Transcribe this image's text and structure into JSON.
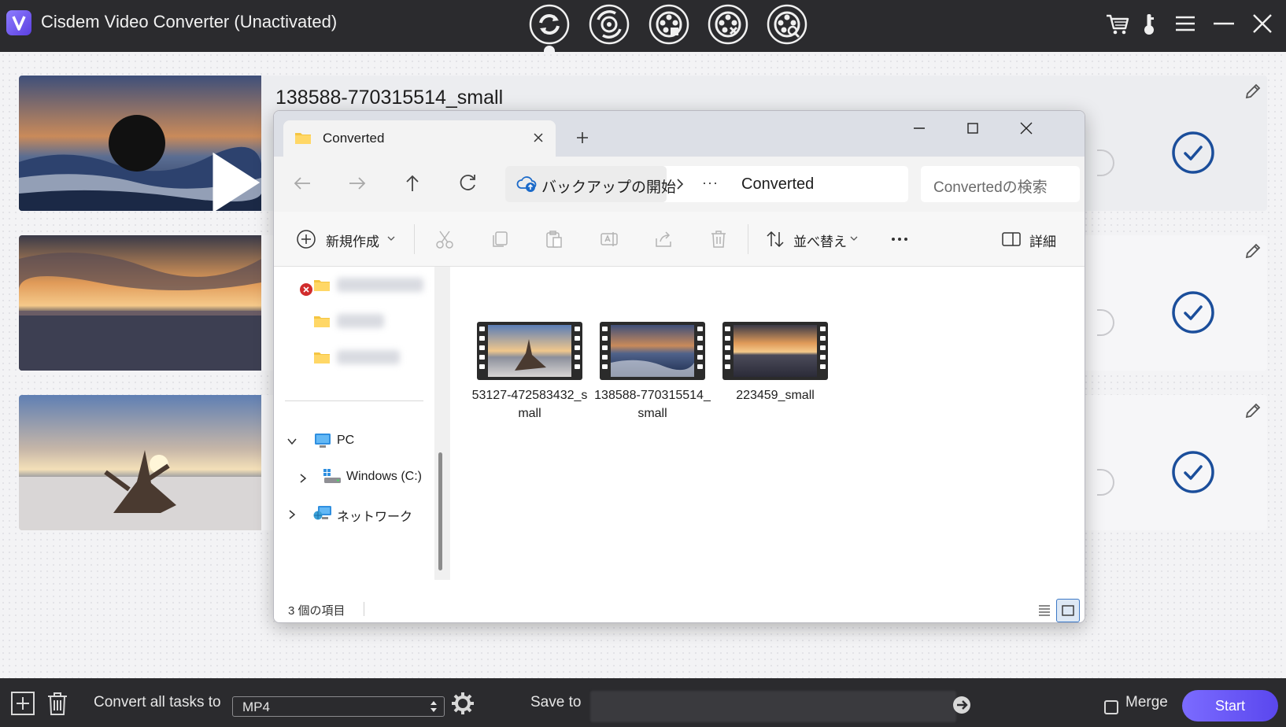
{
  "app": {
    "title": "Cisdem Video Converter (Unactivated)",
    "modes": [
      {
        "name": "convert-mode-icon"
      },
      {
        "name": "rip-mode-icon"
      },
      {
        "name": "dvd-burn-mode-icon"
      },
      {
        "name": "video-edit-mode-icon"
      },
      {
        "name": "download-mode-icon"
      }
    ],
    "accent": "#6a58f7"
  },
  "tasks": [
    {
      "name": "138588-770315514_small",
      "status": "done"
    },
    {
      "name": "",
      "status": "done"
    },
    {
      "name": "",
      "status": "done"
    }
  ],
  "bottom": {
    "convert_label": "Convert all tasks to",
    "format": "MP4",
    "save_label": "Save to",
    "merge_label": "Merge",
    "start_label": "Start"
  },
  "explorer": {
    "tab_title": "Converted",
    "breadcrumb": [
      "バックアップの開始",
      "Converted"
    ],
    "search_placeholder": "Convertedの検索",
    "toolbar": {
      "new_label": "新規作成",
      "sort_label": "並べ替え",
      "details_label": "詳細"
    },
    "sidebar": {
      "pc_label": "PC",
      "drive_label": "Windows (C:)",
      "network_label": "ネットワーク"
    },
    "files": [
      {
        "name": "53127-472583432_small"
      },
      {
        "name": "138588-770315514_small"
      },
      {
        "name": "223459_small"
      }
    ],
    "status": "3 個の項目"
  }
}
